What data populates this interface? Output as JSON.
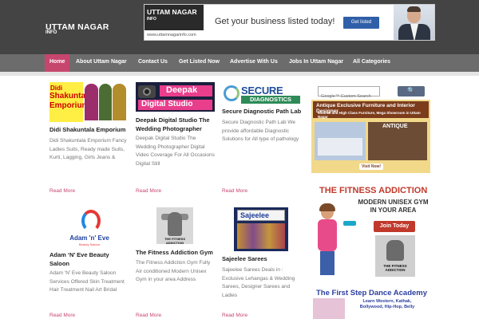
{
  "header": {
    "site_title": "UTTAM NAGAR",
    "site_subtitle": "INFO"
  },
  "banner": {
    "logo_title": "UTTAM NAGAR",
    "logo_sub": "INFO",
    "logo_url": "www.uttamnagarinfo.com",
    "headline": "Get your business listed today!",
    "button": "Get listed"
  },
  "nav": {
    "items": [
      {
        "label": "Home"
      },
      {
        "label": "About Uttam Nagar"
      },
      {
        "label": "Contact Us"
      },
      {
        "label": "Get Listed Now"
      },
      {
        "label": "Advertise With Us"
      },
      {
        "label": "Jobs In Uttam Nagar"
      },
      {
        "label": "All Categories"
      }
    ]
  },
  "posts": [
    {
      "thumb_l1": "Didi",
      "thumb_l2": "Shakuntala",
      "thumb_l3": "Emporium",
      "title": "Didi Shakuntala Emporium",
      "excerpt": "Didi Shakuntala Emporium Fancy Ladies Suits, Ready made Suits, Kurti, Lagging, Girls Jeans &",
      "read_more": "Read More"
    },
    {
      "thumb_l1": "Deepak",
      "thumb_l2": "Digital Studio",
      "title": "Deepak Digital Studio The Wedding Photographer",
      "excerpt": "Deepak Digital Studio The Wedding Photographer Digital Video Coverage For All Occasions Digital Still",
      "read_more": "Read More"
    },
    {
      "thumb_l1": "SECURE",
      "thumb_l2": "DIAGNOSTICS",
      "title": "Secure Diagnostic Path Lab",
      "excerpt": "Secure Diagnostic Path Lab We provide affordable Diagnostic Solutions for All type of pathology",
      "read_more": "Read More"
    },
    {
      "thumb_l1": "Adam 'n' Eve",
      "thumb_l2": "Beauty Saloon",
      "title": "Adam ‘N’ Eve Beauty Saloon",
      "excerpt": "Adam ‘N’ Eve Beauty Saloon Services Offered Skin Treatment Hair Treatment Nail Art Bridal",
      "read_more": "Read More"
    },
    {
      "thumb_l1": "THE FITNESS ADDICTION",
      "title": "The Fitness Addiction Gym",
      "excerpt": "The Fitness Addiction Gym Fully Air conditioned Modern Unisex Gym in your area Address",
      "read_more": "Read More"
    },
    {
      "thumb_l1": "Sajeelee",
      "title": "Sajeelee Sarees",
      "excerpt": "Sajeelee Sarees Deals in : Exclusive Lehangas & Wedding Sarees, Designer Sarees and Ladies",
      "read_more": "Read More"
    }
  ],
  "sidebar": {
    "search_placeholder": "Google™ Custom Search",
    "search_button": "🔍",
    "ad1": {
      "line1": "Antique Exclusive Furniture and Interior Designer",
      "line2": "Modern and High Class Furniture, Mega Showroom in Uttam Nagar",
      "shop_name": "ANTIQUE",
      "visit": "Visit Now!"
    },
    "ad2": {
      "title": "THE FITNESS ADDICTION",
      "subtitle": "MODERN UNISEX GYM IN YOUR AREA",
      "button": "Join Today",
      "logo_text": "THE FITNESS ADDICTION"
    },
    "ad3": {
      "title": "The First Step Dance Academy",
      "text": "Learn Western, Kathak, Bollywood, Hip-Hop, Belly"
    }
  }
}
